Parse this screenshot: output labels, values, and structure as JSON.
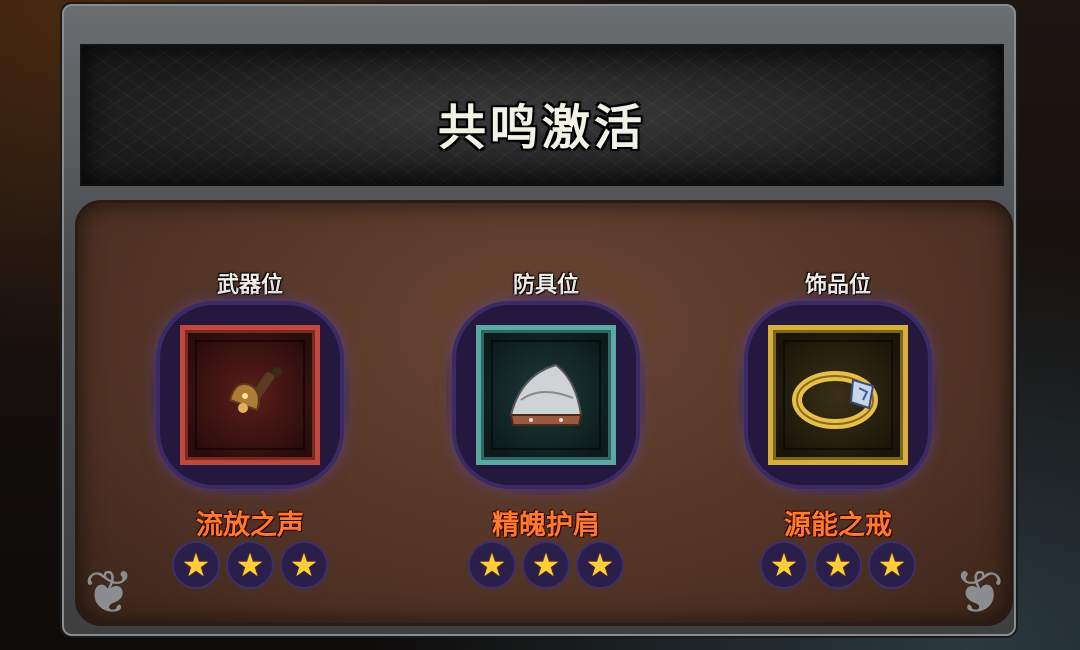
{
  "title": "共鸣激活",
  "slots": [
    {
      "type_label": "武器位",
      "item_name": "流放之声",
      "stars": 3,
      "frame_color": "#c2473b",
      "icon": "bell-icon"
    },
    {
      "type_label": "防具位",
      "item_name": "精魄护肩",
      "stars": 3,
      "frame_color": "#5aa8a4",
      "icon": "pauldron-icon"
    },
    {
      "type_label": "饰品位",
      "item_name": "源能之戒",
      "stars": 3,
      "frame_color": "#d7b03a",
      "icon": "ring-icon"
    }
  ],
  "colors": {
    "item_name": "#ff7a2c",
    "star": "#ffcc3a",
    "panel": "#4d3124"
  }
}
